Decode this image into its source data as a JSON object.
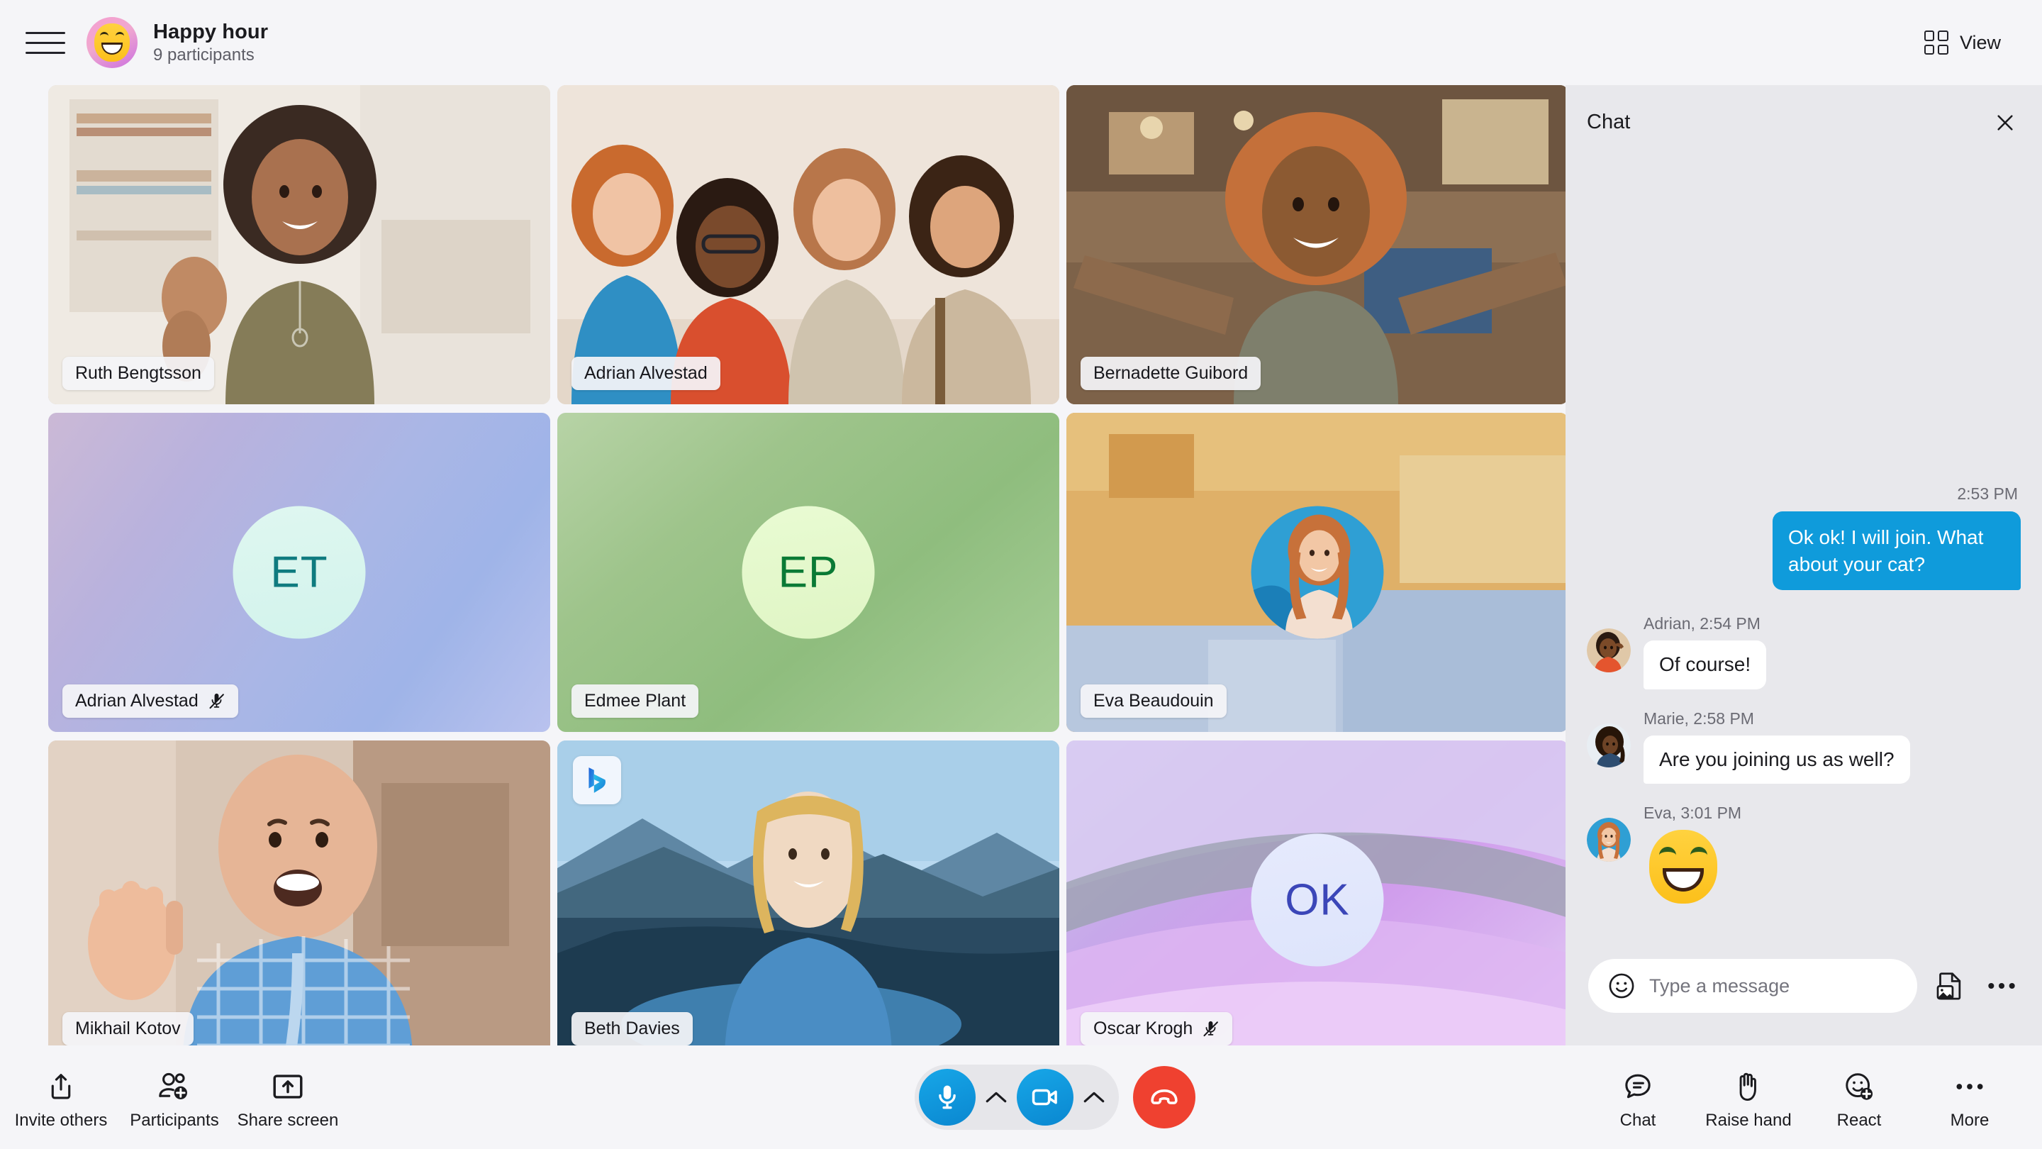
{
  "header": {
    "menu_icon": "hamburger-menu-icon",
    "meeting_avatar_icon": "smiling-face-emoji-avatar",
    "title": "Happy hour",
    "participants": "9 participants",
    "view_label": "View",
    "view_icon": "grid-view-icon"
  },
  "grid": {
    "tiles": [
      {
        "name": "Ruth Bengtsson",
        "muted": false,
        "kind": "video"
      },
      {
        "name": "Adrian Alvestad",
        "muted": false,
        "kind": "video"
      },
      {
        "name": "Bernadette Guibord",
        "muted": false,
        "kind": "video"
      },
      {
        "name": "Adrian Alvestad",
        "muted": true,
        "kind": "avatar",
        "initials": "ET"
      },
      {
        "name": "Edmee Plant",
        "muted": false,
        "kind": "avatar",
        "initials": "EP"
      },
      {
        "name": "Eva Beaudouin",
        "muted": false,
        "kind": "photo"
      },
      {
        "name": "Mikhail Kotov",
        "muted": false,
        "kind": "video"
      },
      {
        "name": "Beth Davies",
        "muted": false,
        "kind": "video",
        "badge": "bing-logo-icon"
      },
      {
        "name": "Oscar Krogh",
        "muted": true,
        "kind": "avatar",
        "initials": "OK"
      }
    ]
  },
  "chat": {
    "title": "Chat",
    "close_icon": "close-icon",
    "messages": [
      {
        "direction": "out",
        "time": "2:53 PM",
        "text": "Ok ok! I will join. What about your cat?"
      },
      {
        "direction": "in",
        "meta": "Adrian, 2:54 PM",
        "text": "Of course!"
      },
      {
        "direction": "in",
        "meta": "Marie, 2:58 PM",
        "text": "Are you joining us as well?"
      },
      {
        "direction": "in",
        "meta": "Eva, 3:01 PM",
        "emoji": "grinning-smiling-eyes-emoji"
      }
    ],
    "compose": {
      "emoji_icon": "emoji-picker-icon",
      "placeholder": "Type a message",
      "value": "",
      "attach_icon": "add-image-icon",
      "more_icon": "more-options-icon"
    }
  },
  "toolbar_left": [
    {
      "label": "Invite others",
      "icon": "share-invite-icon"
    },
    {
      "label": "Participants",
      "icon": "add-person-icon"
    },
    {
      "label": "Share screen",
      "icon": "share-screen-icon"
    }
  ],
  "call_controls": {
    "mic_icon": "microphone-icon",
    "mic_chevron_icon": "chevron-up-icon",
    "camera_icon": "camera-icon",
    "camera_chevron_icon": "chevron-up-icon",
    "hangup_icon": "end-call-icon"
  },
  "toolbar_right": [
    {
      "label": "Chat",
      "icon": "chat-bubble-icon"
    },
    {
      "label": "Raise hand",
      "icon": "raise-hand-icon"
    },
    {
      "label": "React",
      "icon": "add-reaction-icon"
    },
    {
      "label": "More",
      "icon": "more-options-icon"
    }
  ],
  "colors": {
    "accent_blue": "#0f9bdb",
    "hangup_red": "#ef4130",
    "panel_bg": "#e8e8ec",
    "app_bg": "#f5f5f8"
  }
}
